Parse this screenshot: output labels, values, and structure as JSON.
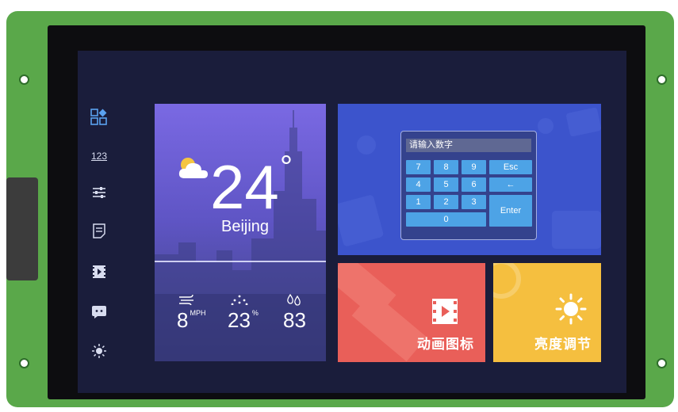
{
  "sidebar": {
    "items": [
      {
        "icon": "dashboard-icon"
      },
      {
        "icon": "numeric-icon",
        "label": "123"
      },
      {
        "icon": "sliders-icon"
      },
      {
        "icon": "document-icon"
      },
      {
        "icon": "video-icon"
      },
      {
        "icon": "chat-icon"
      },
      {
        "icon": "brightness-icon"
      }
    ]
  },
  "weather": {
    "temperature": "24",
    "degree_symbol": "°",
    "city": "Beijing",
    "wind": {
      "value": "8",
      "unit": "MPH"
    },
    "humidity": {
      "value": "23",
      "unit": "%"
    },
    "rain": {
      "value": "83"
    }
  },
  "keypad": {
    "placeholder": "请输入数字",
    "keys": [
      "7",
      "8",
      "9",
      "Esc",
      "4",
      "5",
      "6",
      "←",
      "1",
      "2",
      "3",
      "Enter",
      "0"
    ]
  },
  "tiles": {
    "animation_label": "动画图标",
    "brightness_label": "亮度调节"
  },
  "colors": {
    "screen_bg": "#1a1d3b",
    "keypad_card": "#3c54cc",
    "animation_card": "#e95f59",
    "brightness_card": "#f5bf3f",
    "key": "#4da3e6"
  }
}
